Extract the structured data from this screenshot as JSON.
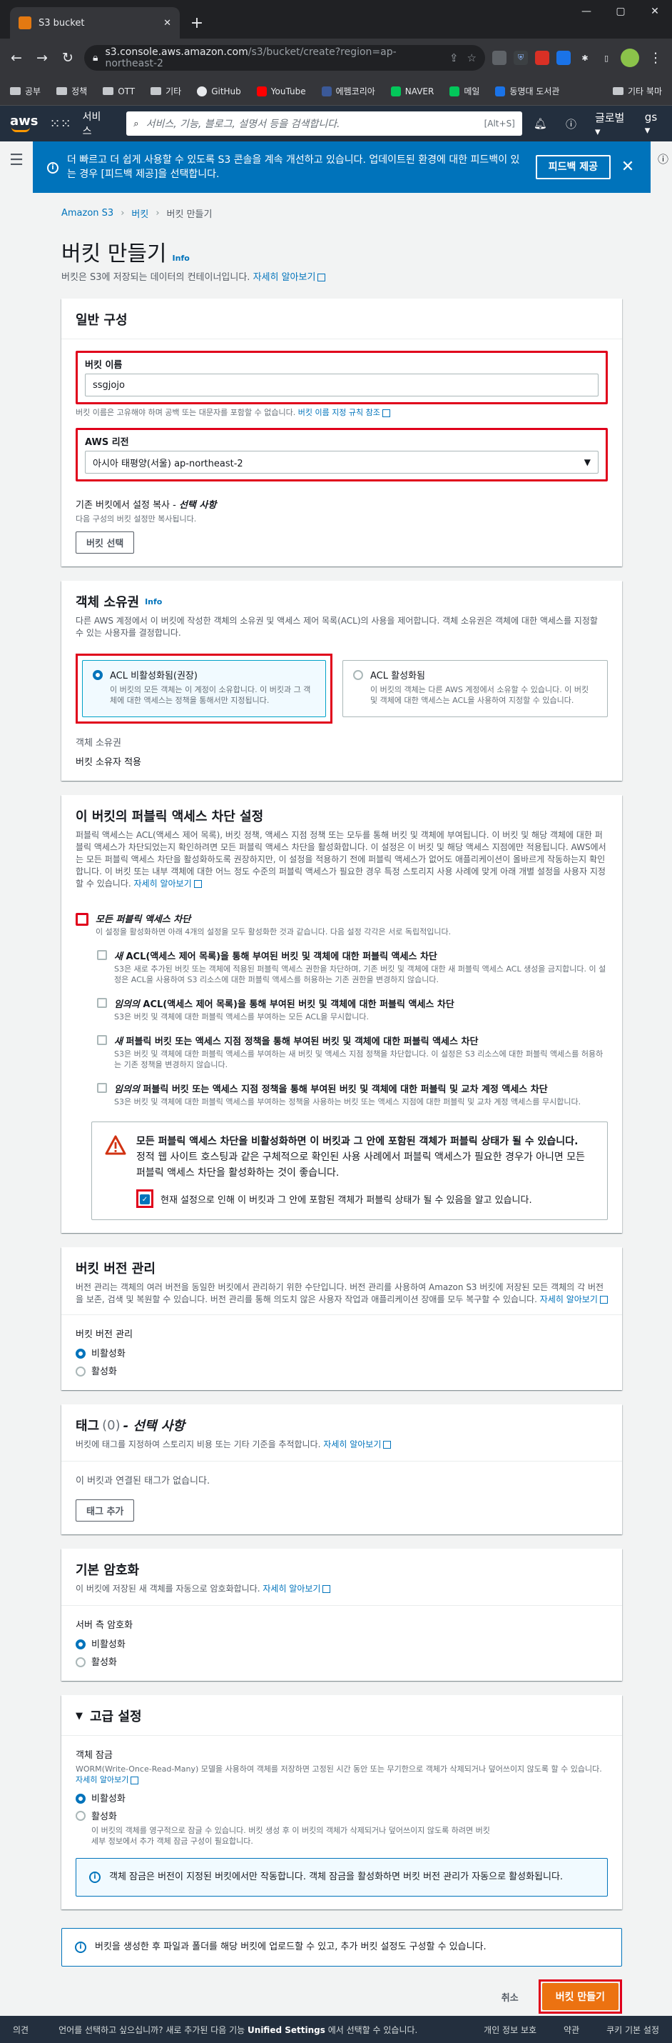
{
  "browser": {
    "tab_title": "S3 bucket",
    "url_host": "s3.console.aws.amazon.com",
    "url_path": "/s3/bucket/create?region=ap-northeast-2",
    "bookmarks": [
      "공부",
      "정책",
      "OTT",
      "기타",
      "GitHub",
      "YouTube",
      "에펨코리아",
      "NAVER",
      "메일",
      "동명대 도서관"
    ],
    "bookmarks_right": "기타 북마"
  },
  "aws_nav": {
    "logo": "aws",
    "services": "서비스",
    "search_placeholder": "서비스, 기능, 블로그, 설명서 등을 검색합니다.",
    "search_shortcut": "[Alt+S]",
    "region": "글로벌 ▾",
    "account": "gs ▾"
  },
  "flash": {
    "text": "더 빠르고 더 쉽게 사용할 수 있도록 S3 콘솔을 계속 개선하고 있습니다. 업데이트된 환경에 대한 피드백이 있는 경우 [피드백 제공]을 선택합니다.",
    "button": "피드백 제공"
  },
  "breadcrumb": [
    "Amazon S3",
    "버킷",
    "버킷 만들기"
  ],
  "page": {
    "title": "버킷 만들기",
    "info": "Info",
    "desc": "버킷은 S3에 저장되는 데이터의 컨테이너입니다.",
    "learn_more": "자세히 알아보기"
  },
  "general": {
    "title": "일반 구성",
    "bucket_name_label": "버킷 이름",
    "bucket_name_value": "ssgjojo",
    "bucket_name_hint": "버킷 이름은 고유해야 하며 공백 또는 대문자를 포함할 수 없습니다.",
    "bucket_name_rules": "버킷 이름 지정 규칙 참조",
    "region_label": "AWS 리전",
    "region_value": "아시아 태평양(서울) ap-northeast-2",
    "copy_label": "기존 버킷에서 설정 복사 - ",
    "copy_optional": "선택 사항",
    "copy_hint": "다음 구성의 버킷 설정만 복사됩니다.",
    "choose_bucket": "버킷 선택"
  },
  "ownership": {
    "title": "객체 소유권",
    "info": "Info",
    "desc": "다른 AWS 계정에서 이 버킷에 작성한 객체의 소유권 및 액세스 제어 목록(ACL)의 사용을 제어합니다. 객체 소유권은 객체에 대한 액세스를 지정할 수 있는 사용자를 결정합니다.",
    "opt1_title": "ACL 비활성화됨(권장)",
    "opt1_desc": "이 버킷의 모든 객체는 이 계정이 소유합니다. 이 버킷과 그 객체에 대한 액세스는 정책을 통해서만 지정됩니다.",
    "opt2_title": "ACL 활성화됨",
    "opt2_desc": "이 버킷의 객체는 다른 AWS 계정에서 소유할 수 있습니다. 이 버킷 및 객체에 대한 액세스는 ACL을 사용하여 지정할 수 있습니다.",
    "owner_label": "객체 소유권",
    "owner_value": "버킷 소유자 적용"
  },
  "block": {
    "title": "이 버킷의 퍼블릭 액세스 차단 설정",
    "desc": "퍼블릭 액세스는 ACL(액세스 제어 목록), 버킷 정책, 액세스 지점 정책 또는 모두를 통해 버킷 및 객체에 부여됩니다. 이 버킷 및 해당 객체에 대한 퍼블릭 액세스가 차단되었는지 확인하려면 모든 퍼블릭 액세스 차단을 활성화합니다. 이 설정은 이 버킷 및 해당 액세스 지점에만 적용됩니다. AWS에서는 모든 퍼블릭 액세스 차단을 활성화하도록 권장하지만, 이 설정을 적용하기 전에 퍼블릭 액세스가 없어도 애플리케이션이 올바르게 작동하는지 확인합니다. 이 버킷 또는 내부 객체에 대한 어느 정도 수준의 퍼블릭 액세스가 필요한 경우 특정 스토리지 사용 사례에 맞게 아래 개별 설정을 사용자 지정할 수 있습니다.",
    "learn_more": "자세히 알아보기",
    "all_title": "모든 퍼블릭 액세스 차단",
    "all_desc": "이 설정을 활성화하면 아래 4개의 설정을 모두 활성화한 것과 같습니다. 다음 설정 각각은 서로 독립적입니다.",
    "items": [
      {
        "em": "새",
        "title": " ACL(액세스 제어 목록)을 통해 부여된 버킷 및 객체에 대한 퍼블릭 액세스 차단",
        "desc": "S3은 새로 추가된 버킷 또는 객체에 적용된 퍼블릭 액세스 권한을 차단하며, 기존 버킷 및 객체에 대한 새 퍼블릭 액세스 ACL 생성을 금지합니다. 이 설정은 ACL을 사용하여 S3 리소스에 대한 퍼블릭 액세스를 허용하는 기존 권한을 변경하지 않습니다."
      },
      {
        "em": "임의의",
        "title": " ACL(액세스 제어 목록)을 통해 부여된 버킷 및 객체에 대한 퍼블릭 액세스 차단",
        "desc": "S3은 버킷 및 객체에 대한 퍼블릭 액세스를 부여하는 모든 ACL을 무시합니다."
      },
      {
        "em": "새",
        "title": " 퍼블릭 버킷 또는 액세스 지점 정책을 통해 부여된 버킷 및 객체에 대한 퍼블릭 액세스 차단",
        "desc": "S3은 버킷 및 객체에 대한 퍼블릭 액세스를 부여하는 새 버킷 및 액세스 지점 정책을 차단합니다. 이 설정은 S3 리소스에 대한 퍼블릭 액세스를 허용하는 기존 정책을 변경하지 않습니다."
      },
      {
        "em": "임의의",
        "title": " 퍼블릭 버킷 또는 액세스 지점 정책을 통해 부여된 버킷 및 객체에 대한 퍼블릭 및 교차 계정 액세스 차단",
        "desc": "S3은 버킷 및 객체에 대한 퍼블릭 액세스를 부여하는 정책을 사용하는 버킷 또는 액세스 지점에 대한 퍼블릭 및 교차 계정 액세스를 무시합니다."
      }
    ],
    "warn_title": "모든 퍼블릭 액세스 차단을 비활성화하면 이 버킷과 그 안에 포함된 객체가 퍼블릭 상태가 될 수 있습니다.",
    "warn_body": "정적 웹 사이트 호스팅과 같은 구체적으로 확인된 사용 사례에서 퍼블릭 액세스가 필요한 경우가 아니면 모든 퍼블릭 액세스 차단을 활성화하는 것이 좋습니다.",
    "ack": "현재 설정으로 인해 이 버킷과 그 안에 포함된 객체가 퍼블릭 상태가 될 수 있음을 알고 있습니다."
  },
  "versioning": {
    "title": "버킷 버전 관리",
    "desc": "버전 관리는 객체의 여러 버전을 동일한 버킷에서 관리하기 위한 수단입니다. 버전 관리를 사용하여 Amazon S3 버킷에 저장된 모든 객체의 각 버전을 보존, 검색 및 복원할 수 있습니다. 버전 관리를 통해 의도치 않은 사용자 작업과 애플리케이션 장애를 모두 복구할 수 있습니다.",
    "learn_more": "자세히 알아보기",
    "label": "버킷 버전 관리",
    "opt_off": "비활성화",
    "opt_on": "활성화"
  },
  "tags": {
    "title": "태그",
    "count": "(0)",
    "optional": " - 선택 사항",
    "desc": "버킷에 태그를 지정하여 스토리지 비용 또는 기타 기준을 추적합니다.",
    "learn_more": "자세히 알아보기",
    "empty": "이 버킷과 연결된 태그가 없습니다.",
    "add": "태그 추가"
  },
  "encryption": {
    "title": "기본 암호화",
    "desc": "이 버킷에 저장된 새 객체를 자동으로 암호화합니다.",
    "learn_more": "자세히 알아보기",
    "label": "서버 측 암호화",
    "opt_off": "비활성화",
    "opt_on": "활성화"
  },
  "advanced": {
    "title": "고급 설정",
    "lock_label": "객체 잠금",
    "lock_desc": "WORM(Write-Once-Read-Many) 모델을 사용하여 객체를 저장하면 고정된 시간 동안 또는 무기한으로 객체가 삭제되거나 덮어쓰이지 않도록 할 수 있습니다.",
    "learn_more": "자세히 알아보기",
    "opt_off": "비활성화",
    "opt_on": "활성화",
    "opt_on_desc": "이 버킷의 객체를 영구적으로 잠글 수 있습니다. 버킷 생성 후 이 버킷의 객체가 삭제되거나 덮어쓰이지 않도록 하려면 버킷 세부 정보에서 추가 객체 잠금 구성이 필요합니다.",
    "notice": "객체 잠금은 버전이 지정된 버킷에서만 작동합니다. 객체 잠금을 활성화하면 버킷 버전 관리가 자동으로 활성화됩니다."
  },
  "bottom_notice": "버킷을 생성한 후 파일과 폴더를 해당 버킷에 업로드할 수 있고, 추가 버킷 설정도 구성할 수 있습니다.",
  "actions": {
    "cancel": "취소",
    "create": "버킷 만들기"
  },
  "footer": {
    "feedback": "의견",
    "lang_text": "언어를 선택하고 싶으십니까? 새로 추가된 다음 기능",
    "unified": "Unified Settings",
    "lang_tail": "에서 선택할 수 있습니다.",
    "privacy": "개인 정보 보호",
    "terms": "약관",
    "cookies": "쿠키 기본 설정"
  }
}
